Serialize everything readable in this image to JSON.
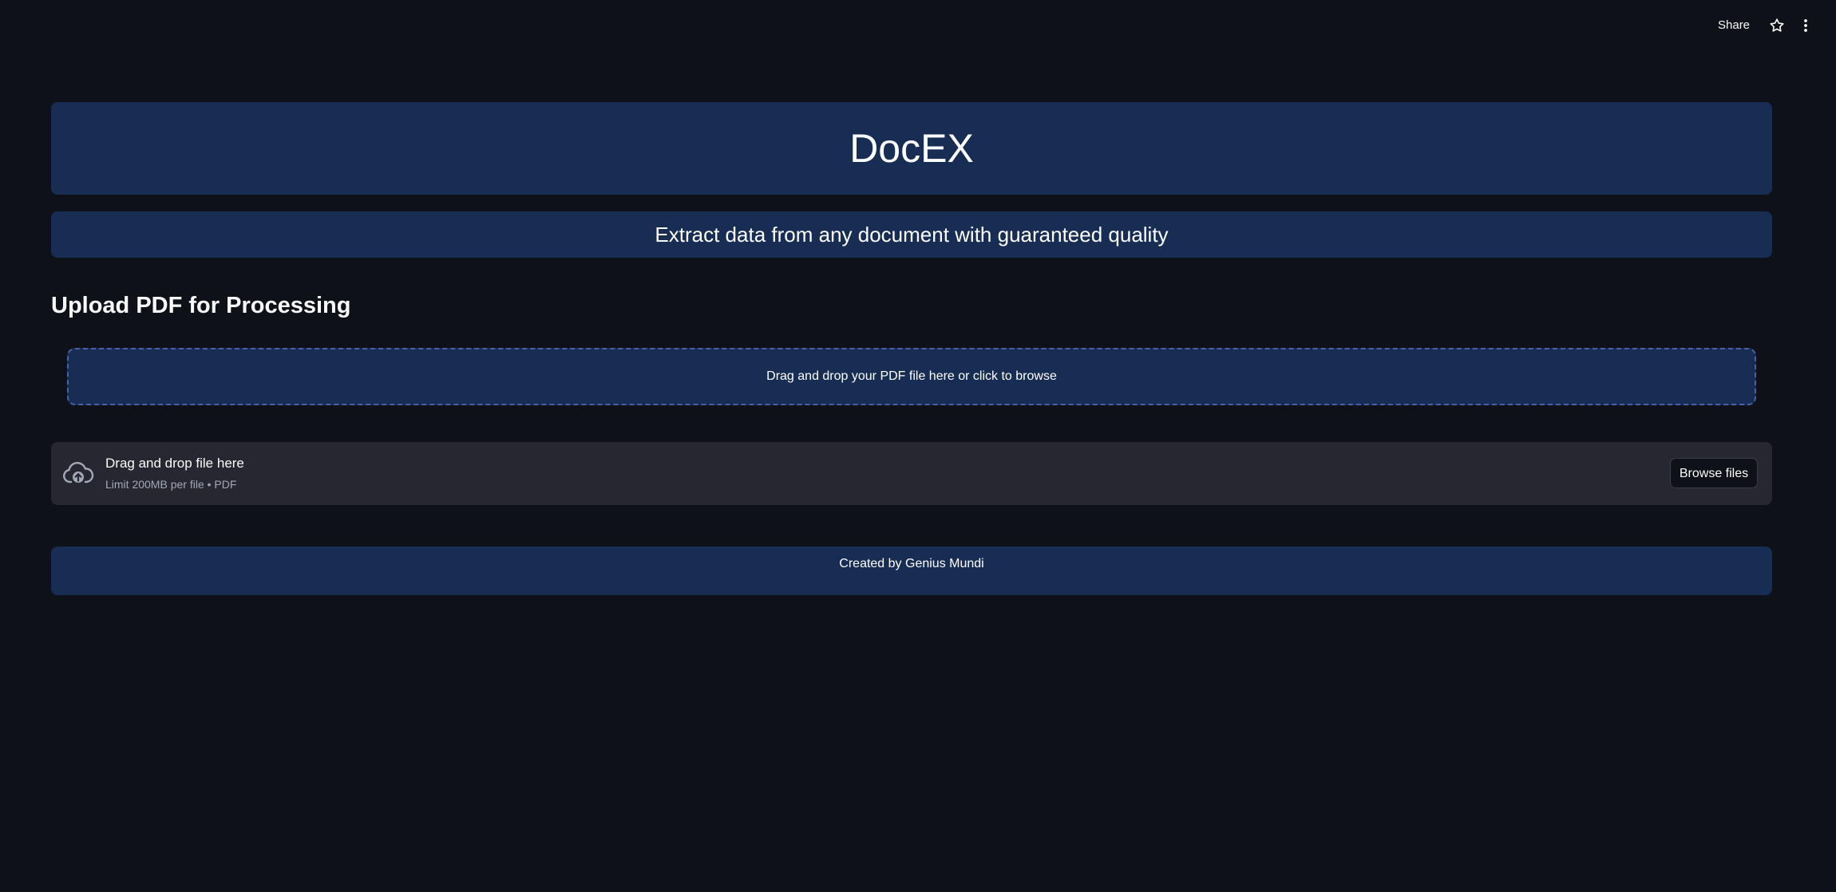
{
  "toolbar": {
    "share_label": "Share",
    "star_icon": "star-icon",
    "menu_icon": "kebab-menu-icon"
  },
  "header": {
    "title": "DocEX",
    "subtitle": "Extract data from any document with guaranteed quality"
  },
  "main": {
    "section_heading": "Upload PDF for Processing",
    "dropzone_text": "Drag and drop your PDF file here or click to browse",
    "uploader": {
      "icon": "cloud-upload-icon",
      "title": "Drag and drop file here",
      "limit": "Limit 200MB per file • PDF",
      "browse_label": "Browse files"
    }
  },
  "footer": {
    "text": "Created by Genius Mundi"
  },
  "colors": {
    "background": "#0e1117",
    "banner": "#172d54",
    "uploader_bg": "#262730",
    "dropzone_border": "#4b5fa6"
  }
}
